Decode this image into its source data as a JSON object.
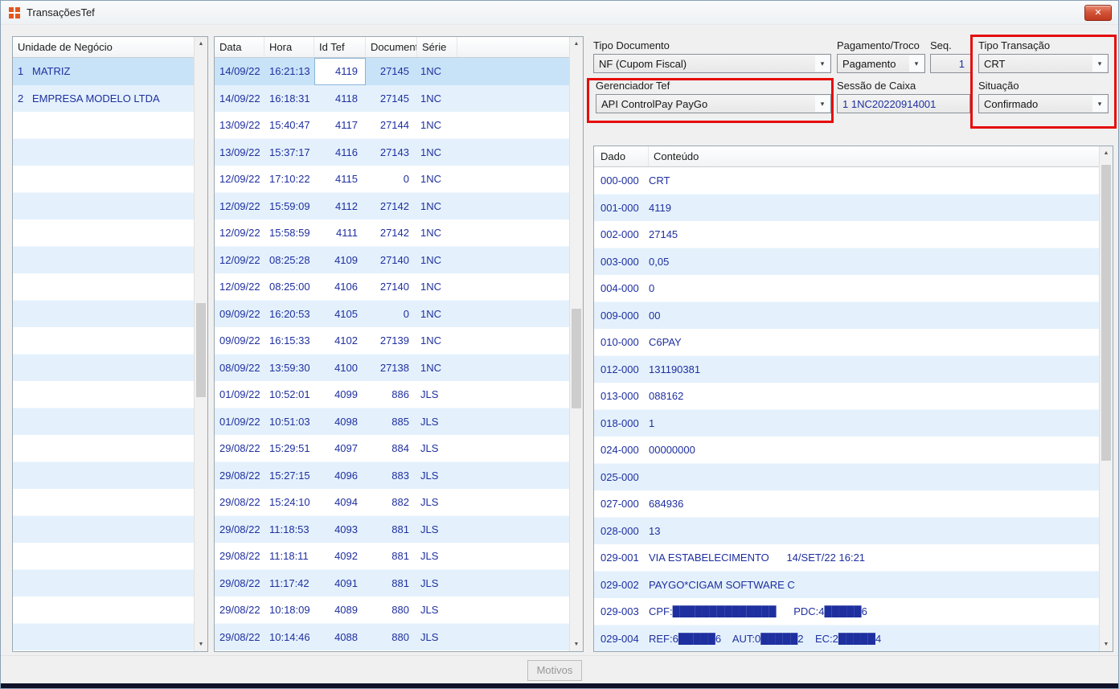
{
  "window": {
    "title": "TransaçõesTef",
    "close_glyph": "✕"
  },
  "left_panel": {
    "header": "Unidade de Negócio",
    "rows": [
      {
        "num": "1",
        "name": "MATRIZ",
        "selected": true
      },
      {
        "num": "2",
        "name": "EMPRESA MODELO LTDA"
      }
    ]
  },
  "transactions": {
    "columns": [
      "Data",
      "Hora",
      "Id Tef",
      "Documento",
      "Série"
    ],
    "rows": [
      {
        "data": "14/09/22",
        "hora": "16:21:13",
        "id": "4119",
        "doc": "27145",
        "serie": "1NC",
        "selected": true
      },
      {
        "data": "14/09/22",
        "hora": "16:18:31",
        "id": "4118",
        "doc": "27145",
        "serie": "1NC"
      },
      {
        "data": "13/09/22",
        "hora": "15:40:47",
        "id": "4117",
        "doc": "27144",
        "serie": "1NC"
      },
      {
        "data": "13/09/22",
        "hora": "15:37:17",
        "id": "4116",
        "doc": "27143",
        "serie": "1NC"
      },
      {
        "data": "12/09/22",
        "hora": "17:10:22",
        "id": "4115",
        "doc": "0",
        "serie": "1NC"
      },
      {
        "data": "12/09/22",
        "hora": "15:59:09",
        "id": "4112",
        "doc": "27142",
        "serie": "1NC"
      },
      {
        "data": "12/09/22",
        "hora": "15:58:59",
        "id": "4111",
        "doc": "27142",
        "serie": "1NC"
      },
      {
        "data": "12/09/22",
        "hora": "08:25:28",
        "id": "4109",
        "doc": "27140",
        "serie": "1NC"
      },
      {
        "data": "12/09/22",
        "hora": "08:25:00",
        "id": "4106",
        "doc": "27140",
        "serie": "1NC"
      },
      {
        "data": "09/09/22",
        "hora": "16:20:53",
        "id": "4105",
        "doc": "0",
        "serie": "1NC"
      },
      {
        "data": "09/09/22",
        "hora": "16:15:33",
        "id": "4102",
        "doc": "27139",
        "serie": "1NC"
      },
      {
        "data": "08/09/22",
        "hora": "13:59:30",
        "id": "4100",
        "doc": "27138",
        "serie": "1NC"
      },
      {
        "data": "01/09/22",
        "hora": "10:52:01",
        "id": "4099",
        "doc": "886",
        "serie": "JLS"
      },
      {
        "data": "01/09/22",
        "hora": "10:51:03",
        "id": "4098",
        "doc": "885",
        "serie": "JLS"
      },
      {
        "data": "29/08/22",
        "hora": "15:29:51",
        "id": "4097",
        "doc": "884",
        "serie": "JLS"
      },
      {
        "data": "29/08/22",
        "hora": "15:27:15",
        "id": "4096",
        "doc": "883",
        "serie": "JLS"
      },
      {
        "data": "29/08/22",
        "hora": "15:24:10",
        "id": "4094",
        "doc": "882",
        "serie": "JLS"
      },
      {
        "data": "29/08/22",
        "hora": "11:18:53",
        "id": "4093",
        "doc": "881",
        "serie": "JLS"
      },
      {
        "data": "29/08/22",
        "hora": "11:18:11",
        "id": "4092",
        "doc": "881",
        "serie": "JLS"
      },
      {
        "data": "29/08/22",
        "hora": "11:17:42",
        "id": "4091",
        "doc": "881",
        "serie": "JLS"
      },
      {
        "data": "29/08/22",
        "hora": "10:18:09",
        "id": "4089",
        "doc": "880",
        "serie": "JLS"
      },
      {
        "data": "29/08/22",
        "hora": "10:14:46",
        "id": "4088",
        "doc": "880",
        "serie": "JLS"
      }
    ]
  },
  "form": {
    "tipo_documento": {
      "label": "Tipo Documento",
      "value": "NF (Cupom Fiscal)"
    },
    "pagamento_troco": {
      "label": "Pagamento/Troco",
      "value": "Pagamento"
    },
    "seq": {
      "label": "Seq.",
      "value": "1"
    },
    "tipo_transacao": {
      "label": "Tipo Transação",
      "value": "CRT"
    },
    "gerenciador_tef": {
      "label": "Gerenciador Tef",
      "value": "API ControlPay PayGo"
    },
    "sessao_caixa": {
      "label": "Sessão de Caixa",
      "value": "1 1NC20220914001"
    },
    "situacao": {
      "label": "Situação",
      "value": "Confirmado"
    }
  },
  "details": {
    "columns": [
      "Dado",
      "Conteúdo"
    ],
    "rows": [
      {
        "dado": "000-000",
        "conteudo": "CRT"
      },
      {
        "dado": "001-000",
        "conteudo": "4119"
      },
      {
        "dado": "002-000",
        "conteudo": "27145"
      },
      {
        "dado": "003-000",
        "conteudo": "0,05"
      },
      {
        "dado": "004-000",
        "conteudo": "0"
      },
      {
        "dado": "009-000",
        "conteudo": "00"
      },
      {
        "dado": "010-000",
        "conteudo": "C6PAY"
      },
      {
        "dado": "012-000",
        "conteudo": "131190381"
      },
      {
        "dado": "013-000",
        "conteudo": "088162"
      },
      {
        "dado": "018-000",
        "conteudo": "1"
      },
      {
        "dado": "024-000",
        "conteudo": "00000000"
      },
      {
        "dado": "025-000",
        "conteudo": ""
      },
      {
        "dado": "027-000",
        "conteudo": "684936"
      },
      {
        "dado": "028-000",
        "conteudo": "13"
      },
      {
        "dado": "029-001",
        "conteudo": "VIA ESTABELECIMENTO      14/SET/22 16:21"
      },
      {
        "dado": "029-002",
        "conteudo": "PAYGO*CIGAM SOFTWARE C"
      },
      {
        "dado": "029-003",
        "conteudo": "CPF:██████████████      PDC:4█████6"
      },
      {
        "dado": "029-004",
        "conteudo": "REF:6█████6    AUT:0█████2    EC:2█████4"
      }
    ]
  },
  "footer": {
    "motivos": "Motivos"
  },
  "annotation_color": "#e60c0c"
}
